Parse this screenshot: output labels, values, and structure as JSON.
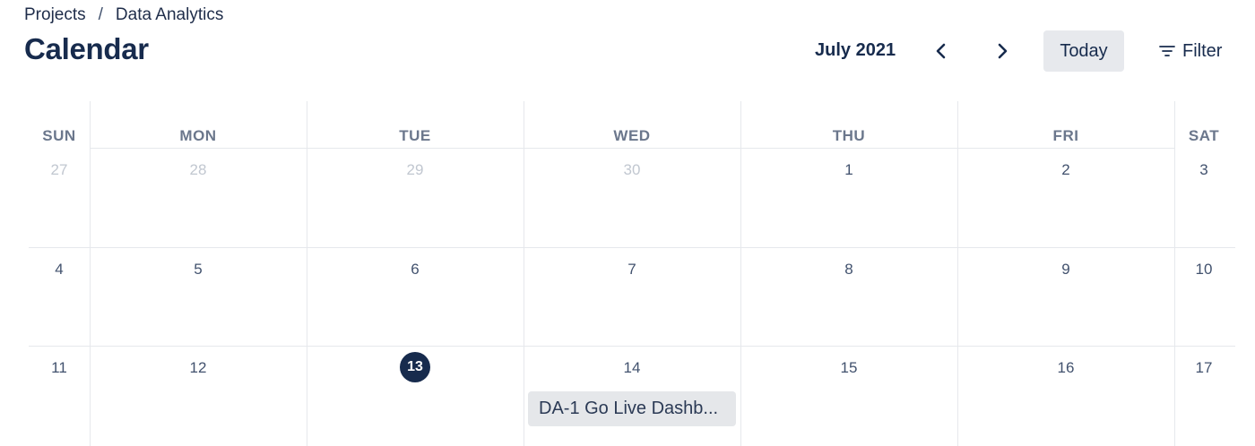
{
  "breadcrumb": {
    "items": [
      "Projects",
      "Data Analytics"
    ],
    "separator": "/"
  },
  "page": {
    "title": "Calendar"
  },
  "toolbar": {
    "month_label": "July 2021",
    "today_label": "Today",
    "filter_label": "Filter",
    "prev_icon": "chevron-left-icon",
    "next_icon": "chevron-right-icon",
    "filter_icon": "filter-lines-icon"
  },
  "calendar": {
    "weekdays": [
      "SUN",
      "MON",
      "TUE",
      "WED",
      "THU",
      "FRI",
      "SAT"
    ],
    "weeks": [
      [
        "27",
        "28",
        "29",
        "30",
        "1",
        "2",
        "3"
      ],
      [
        "4",
        "5",
        "6",
        "7",
        "8",
        "9",
        "10"
      ],
      [
        "11",
        "12",
        "13",
        "14",
        "15",
        "16",
        "17"
      ]
    ],
    "previous_month_days": [
      "27",
      "28",
      "29",
      "30"
    ],
    "today": "13",
    "event": {
      "label": "DA-1 Go Live Dashb...",
      "day": "14"
    }
  },
  "colors": {
    "text": "#172b4d",
    "muted_day": "#c1c7d0",
    "today_circle": "#172b4d",
    "today_button_bg": "#e7e9ed",
    "event_bg": "#e5e7ea",
    "grid_line": "#e6e8ec"
  }
}
